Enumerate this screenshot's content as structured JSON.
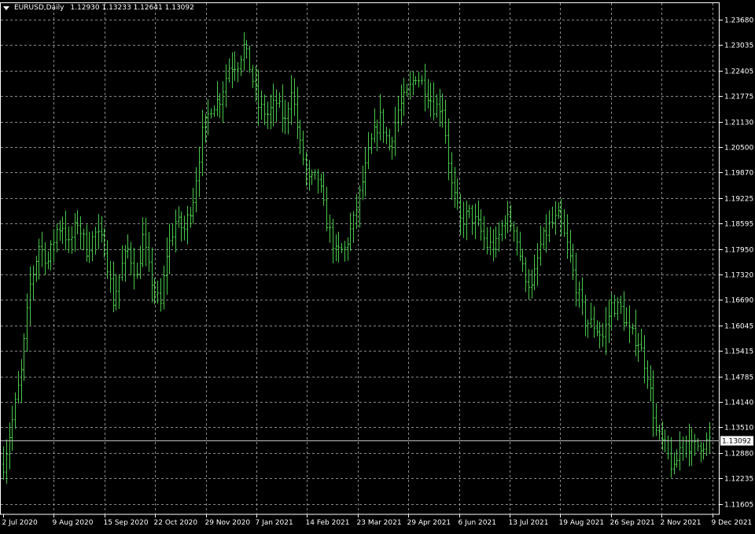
{
  "header": {
    "symbol": "EURUSD,Daily",
    "ohlc": "1.12930 1.13233 1.12641 1.13092"
  },
  "colors": {
    "background": "#000000",
    "bars": "#47c84a",
    "grid": "#8a8a8a",
    "axis": "#ffffff",
    "price_line": "#c0c0c0"
  },
  "chart_data": {
    "type": "bar",
    "symbol": "EURUSD",
    "timeframe": "Daily",
    "ylim": [
      1.116,
      1.24
    ],
    "grid": true,
    "current_price": "1.13092",
    "y_ticks": [
      "1.23680",
      "1.23035",
      "1.22405",
      "1.21775",
      "1.21130",
      "1.20500",
      "1.19870",
      "1.19225",
      "1.18595",
      "1.17950",
      "1.17320",
      "1.16690",
      "1.16045",
      "1.15415",
      "1.14785",
      "1.14140",
      "1.13510",
      "1.12880",
      "1.12235",
      "1.11605"
    ],
    "x_ticks": [
      "2 Jul 2020",
      "9 Aug 2020",
      "15 Sep 2020",
      "22 Oct 2020",
      "29 Nov 2020",
      "7 Jan 2021",
      "14 Feb 2021",
      "23 Mar 2021",
      "29 Apr 2021",
      "6 Jun 2021",
      "13 Jul 2021",
      "19 Aug 2021",
      "26 Sep 2021",
      "2 Nov 2021",
      "9 Dec 2021"
    ],
    "close_path": [
      [
        0,
        1.125
      ],
      [
        3,
        1.136
      ],
      [
        6,
        1.148
      ],
      [
        9,
        1.17
      ],
      [
        12,
        1.18
      ],
      [
        15,
        1.176
      ],
      [
        18,
        1.184
      ],
      [
        20,
        1.185
      ],
      [
        22,
        1.18
      ],
      [
        25,
        1.186
      ],
      [
        28,
        1.179
      ],
      [
        31,
        1.183
      ],
      [
        34,
        1.18
      ],
      [
        37,
        1.166
      ],
      [
        40,
        1.175
      ],
      [
        42,
        1.179
      ],
      [
        45,
        1.172
      ],
      [
        47,
        1.182
      ],
      [
        49,
        1.174
      ],
      [
        51,
        1.168
      ],
      [
        53,
        1.165
      ],
      [
        55,
        1.178
      ],
      [
        58,
        1.186
      ],
      [
        61,
        1.184
      ],
      [
        64,
        1.192
      ],
      [
        67,
        1.208
      ],
      [
        70,
        1.215
      ],
      [
        73,
        1.217
      ],
      [
        76,
        1.225
      ],
      [
        79,
        1.226
      ],
      [
        81,
        1.23
      ],
      [
        83,
        1.225
      ],
      [
        86,
        1.215
      ],
      [
        89,
        1.213
      ],
      [
        92,
        1.216
      ],
      [
        95,
        1.211
      ],
      [
        97,
        1.22
      ],
      [
        100,
        1.205
      ],
      [
        103,
        1.196
      ],
      [
        106,
        1.197
      ],
      [
        109,
        1.186
      ],
      [
        112,
        1.178
      ],
      [
        115,
        1.179
      ],
      [
        118,
        1.186
      ],
      [
        121,
        1.196
      ],
      [
        124,
        1.206
      ],
      [
        127,
        1.212
      ],
      [
        130,
        1.205
      ],
      [
        133,
        1.214
      ],
      [
        136,
        1.218
      ],
      [
        139,
        1.223
      ],
      [
        142,
        1.22
      ],
      [
        145,
        1.215
      ],
      [
        148,
        1.215
      ],
      [
        151,
        1.195
      ],
      [
        154,
        1.186
      ],
      [
        157,
        1.188
      ],
      [
        160,
        1.185
      ],
      [
        163,
        1.18
      ],
      [
        166,
        1.18
      ],
      [
        169,
        1.187
      ],
      [
        172,
        1.185
      ],
      [
        175,
        1.174
      ],
      [
        178,
        1.169
      ],
      [
        181,
        1.18
      ],
      [
        184,
        1.185
      ],
      [
        187,
        1.187
      ],
      [
        190,
        1.18
      ],
      [
        193,
        1.17
      ],
      [
        196,
        1.161
      ],
      [
        199,
        1.16
      ],
      [
        202,
        1.157
      ],
      [
        205,
        1.165
      ],
      [
        208,
        1.164
      ],
      [
        211,
        1.158
      ],
      [
        214,
        1.156
      ],
      [
        217,
        1.148
      ],
      [
        220,
        1.133
      ],
      [
        223,
        1.129
      ],
      [
        226,
        1.123
      ],
      [
        229,
        1.132
      ],
      [
        232,
        1.129
      ],
      [
        235,
        1.13
      ],
      [
        238,
        1.1309
      ]
    ]
  }
}
